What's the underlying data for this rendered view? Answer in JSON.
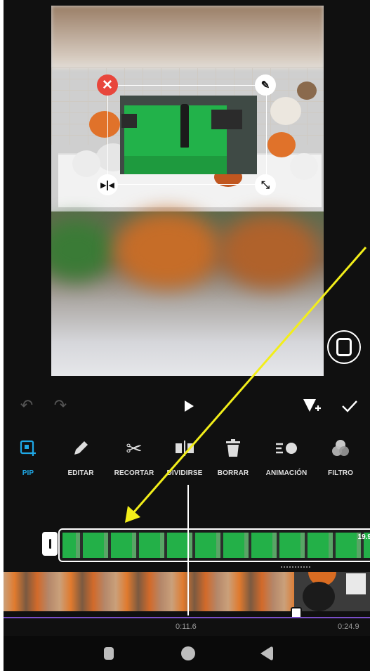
{
  "toolbar": {
    "items": [
      {
        "label": "PIP",
        "icon": "pip-icon",
        "active": true
      },
      {
        "label": "EDITAR",
        "icon": "pencil-icon"
      },
      {
        "label": "RECORTAR",
        "icon": "scissors-icon"
      },
      {
        "label": "DIVIDIRSE",
        "icon": "split-icon"
      },
      {
        "label": "BORRAR",
        "icon": "trash-icon"
      },
      {
        "label": "ANIMACIÓN",
        "icon": "animation-icon"
      },
      {
        "label": "FILTRO",
        "icon": "filter-icon"
      }
    ]
  },
  "timeline": {
    "clip_duration": "19.9",
    "time_current": "0:11.6",
    "time_total": "0:24.9"
  },
  "colors": {
    "accent": "#1fa8e6",
    "timeline_line": "#7a4ec9",
    "annotation_arrow": "#f2ee1a",
    "close_handle": "#e8463c"
  }
}
